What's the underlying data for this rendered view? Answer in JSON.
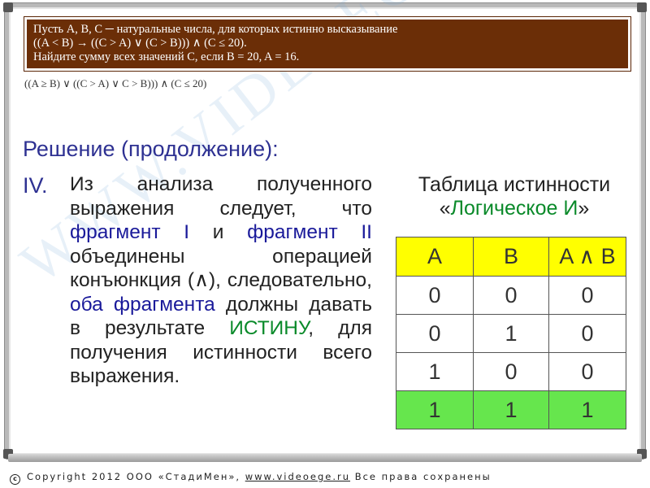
{
  "watermark": "WWW.VIDEOEGE.RU",
  "task": {
    "line1": "Пусть A, B, C ─ натуральные числа, для которых истинно высказывание",
    "line2": "((A < B) → ((C > A) ∨ (C > B))) ∧ (C ≤ 20).",
    "line3": "Найдите сумму всех значений  C,  если B = 20,  A = 16."
  },
  "formula": "((A ≥ B) ∨ ((C > A) ∨ C > B))) ∧ (C ≤ 20)",
  "heading": "Решение (продолжение):",
  "section_number": "IV.",
  "paragraph": {
    "p1": "Из анализа полученного выражения следует, что ",
    "frag1": "фрагмент I",
    "p2": " и ",
    "frag2": "фрагмент II",
    "p3": " объединены операцией конъюнкция (",
    "op": "∧",
    "p4": "), следовательно, ",
    "both": "оба фрагмента",
    "p5": " должны давать в результате ",
    "truth": "ИСТИНУ",
    "p6": ", для получения истинности всего выражения."
  },
  "table_title": {
    "line1": "Таблица истинности",
    "open_quote": "«",
    "name": "Логическое И",
    "close_quote": "»"
  },
  "truth_table": {
    "headers": [
      "A",
      "B",
      "A ∧ B"
    ],
    "rows": [
      [
        "0",
        "0",
        "0"
      ],
      [
        "0",
        "1",
        "0"
      ],
      [
        "1",
        "0",
        "0"
      ],
      [
        "1",
        "1",
        "1"
      ]
    ]
  },
  "footer": {
    "copyright_symbol": "c",
    "text": "Copyright 2012 ООО «СтадиМен», ",
    "link": "www.videoege.ru",
    "rights": "  Все права сохранены"
  }
}
